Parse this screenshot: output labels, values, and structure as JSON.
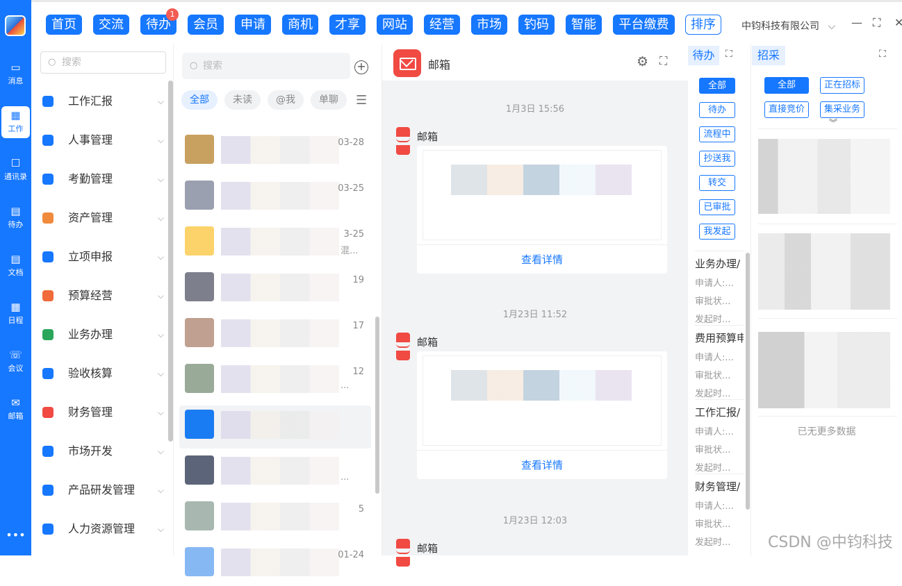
{
  "rail": {
    "items": [
      {
        "label": "消息",
        "icon": "message-icon",
        "glyph": "▭"
      },
      {
        "label": "工作",
        "icon": "grid-icon",
        "glyph": "▦"
      },
      {
        "label": "通讯录",
        "icon": "contacts-icon",
        "glyph": "☐"
      },
      {
        "label": "待办",
        "icon": "todo-icon",
        "glyph": "▤"
      },
      {
        "label": "文档",
        "icon": "document-icon",
        "glyph": "▤"
      },
      {
        "label": "日程",
        "icon": "calendar-icon",
        "glyph": "▦"
      },
      {
        "label": "会议",
        "icon": "meeting-icon",
        "glyph": "☏"
      },
      {
        "label": "邮箱",
        "icon": "mail-icon",
        "glyph": "✉"
      }
    ],
    "more": "•••"
  },
  "nav": {
    "buttons": [
      "首页",
      "交流",
      "待办",
      "会员",
      "申请",
      "商机",
      "才享",
      "网站",
      "经营",
      "市场",
      "钓码",
      "智能",
      "平台缴费"
    ],
    "sort": "排序",
    "badge": "1",
    "company": "中钧科技有限公司",
    "company_chevron": "⌵",
    "minimize": "—",
    "maximize": "⛶",
    "close": "✕"
  },
  "menu": {
    "search_placeholder": "搜索",
    "items": [
      "工作汇报",
      "人事管理",
      "考勤管理",
      "资产管理",
      "立项申报",
      "预算经营",
      "业务办理",
      "验收核算",
      "财务管理",
      "市场开发",
      "产品研发管理",
      "人力资源管理"
    ],
    "colors": [
      "#1677ff",
      "#1677ff",
      "#1677ff",
      "#f08b3e",
      "#1677ff",
      "#f06a3a",
      "#2aa65a",
      "#1677ff",
      "#f04a43",
      "#1677ff",
      "#1677ff",
      "#1677ff"
    ]
  },
  "chats": {
    "search_placeholder": "搜索",
    "filters": [
      "全部",
      "未读",
      "@我",
      "单聊"
    ],
    "items": [
      {
        "date": "03-28",
        "snippet": ""
      },
      {
        "date": "03-25",
        "snippet": ""
      },
      {
        "date": "3-25",
        "snippet": "混..."
      },
      {
        "date": "19",
        "snippet": ""
      },
      {
        "date": "17",
        "snippet": ""
      },
      {
        "date": "12",
        "snippet": "..."
      },
      {
        "date": "",
        "snippet": ""
      },
      {
        "date": "",
        "snippet": "..."
      },
      {
        "date": "5",
        "snippet": ""
      },
      {
        "date": "01-24",
        "snippet": ""
      }
    ]
  },
  "mail": {
    "title": "邮箱",
    "messages": [
      {
        "time": "1月3日 15:56",
        "sender": "邮箱",
        "more": "查看详情"
      },
      {
        "time": "1月23日 11:52",
        "sender": "邮箱",
        "more": "查看详情"
      },
      {
        "time": "1月23日 12:03",
        "sender": "邮箱",
        "more": ""
      }
    ]
  },
  "todo": {
    "title": "待办",
    "chips": [
      "全部",
      "待办",
      "流程中",
      "抄送我",
      "转交",
      "已审批",
      "我发起"
    ],
    "cards": [
      {
        "title": "业务办理/",
        "l1": "申请人:...",
        "l2": "审批状...",
        "l3": "发起时..."
      },
      {
        "title": "费用预算申",
        "l1": "申请人:...",
        "l2": "审批状...",
        "l3": "发起时..."
      },
      {
        "title": "工作汇报/",
        "l1": "申请人:...",
        "l2": "审批状...",
        "l3": "发起时..."
      },
      {
        "title": "财务管理/",
        "l1": "申请人:...",
        "l2": "审批状...",
        "l3": "发起时..."
      }
    ]
  },
  "proc": {
    "title": "招采",
    "chips": [
      "全部",
      "正在招标",
      "直接竞价",
      "集采业务"
    ],
    "no_more": "已无更多数据"
  },
  "watermark": "CSDN @中钧科技"
}
